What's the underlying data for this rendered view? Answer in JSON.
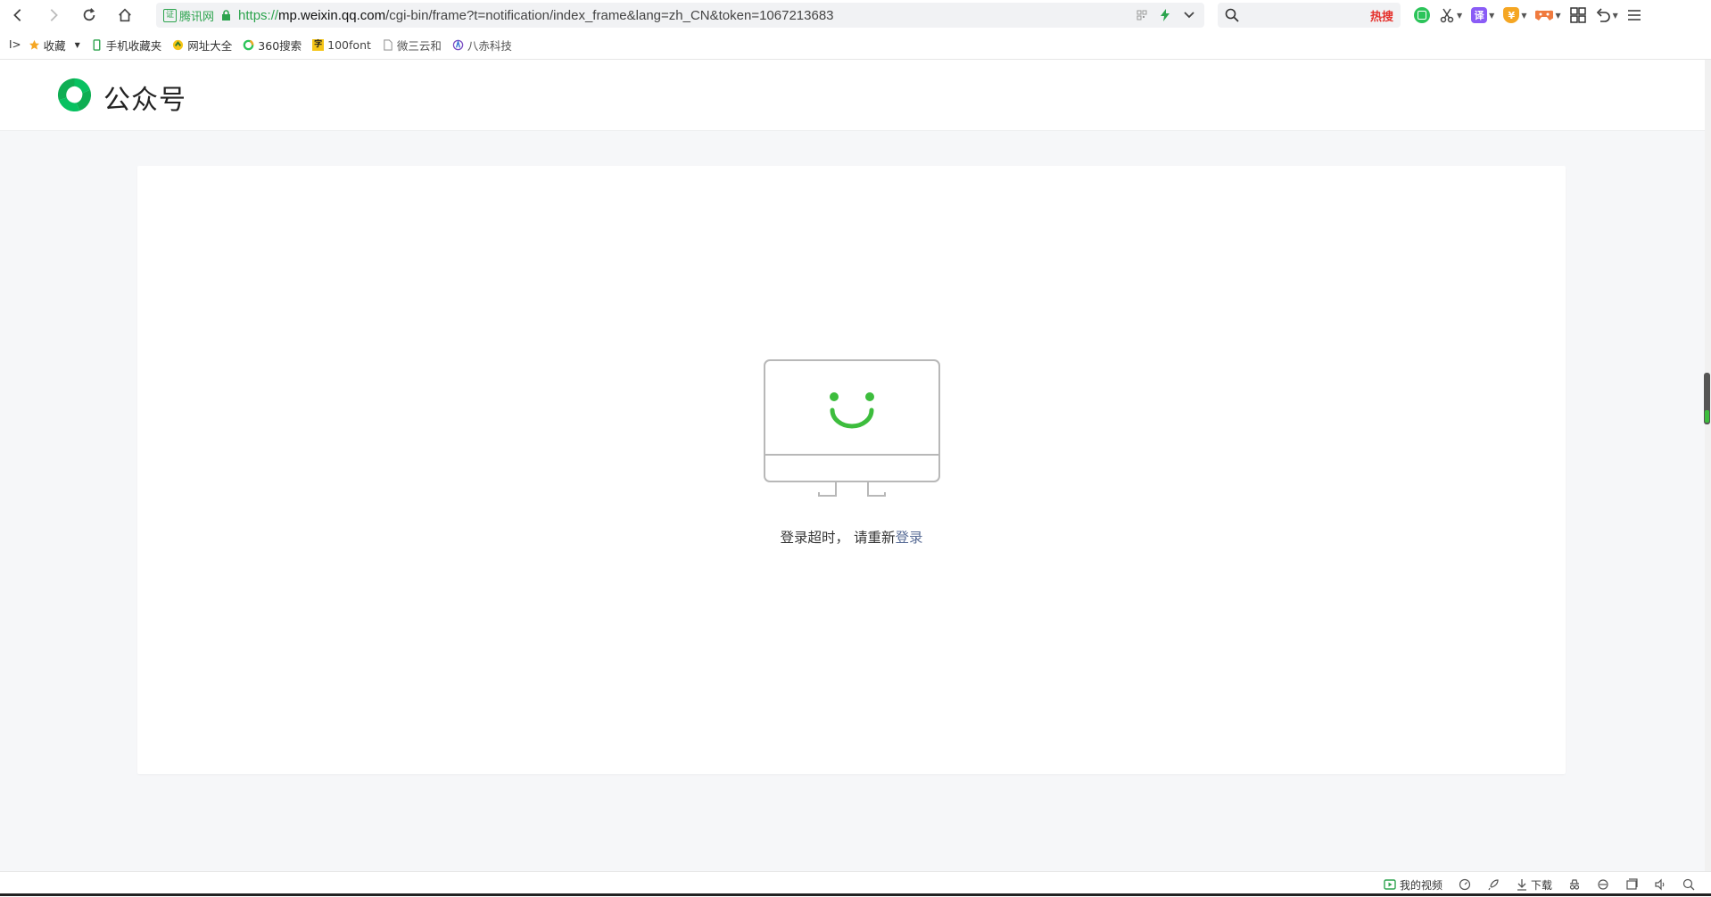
{
  "browser": {
    "url": {
      "cert_label": "腾讯网",
      "cert_mark": "证",
      "protocol": "https://",
      "host": "mp.weixin.qq.com",
      "path": "/cgi-bin/frame?t=notification/index_frame&lang=zh_CN&token=1067213683"
    },
    "search": {
      "hot_label": "热搜"
    },
    "tools": [
      "green-app-icon",
      "scissors-icon",
      "translate-icon",
      "shield-icon",
      "game-icon",
      "grid-icon",
      "undo-icon",
      "menu-icon"
    ],
    "translate_label": "译",
    "shield_label": "¥"
  },
  "bookmarks": {
    "toggle": "I>",
    "items": [
      {
        "label": "收藏",
        "icon": "star-icon"
      },
      {
        "label": "手机收藏夹",
        "icon": "phone-icon"
      },
      {
        "label": "网址大全",
        "icon": "sites-icon"
      },
      {
        "label": "360搜索",
        "icon": "search-360-icon"
      },
      {
        "label": "100font",
        "icon": "font-icon"
      },
      {
        "label": "微三云和",
        "icon": "page-icon"
      },
      {
        "label": "八赤科技",
        "icon": "tech-icon"
      }
    ],
    "font_badge": "字"
  },
  "page": {
    "brand": "公众号",
    "message": {
      "text": "登录超时， 请重新",
      "link": "登录"
    }
  },
  "statusbar": {
    "my_videos": "我的视频",
    "download": "下载"
  },
  "colors": {
    "accent_green": "#07c160",
    "link_blue": "#576b95",
    "smile_green": "#3dbd3d"
  }
}
